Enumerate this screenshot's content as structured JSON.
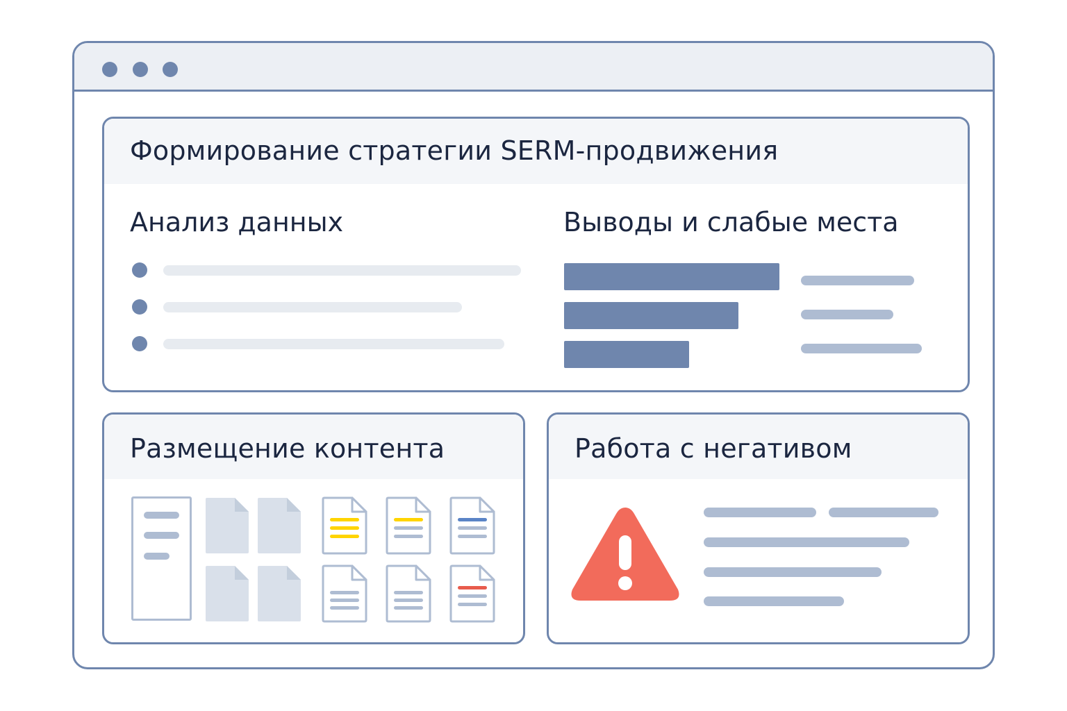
{
  "window": {
    "controls": [
      "dot-1",
      "dot-2",
      "dot-3"
    ]
  },
  "strategy": {
    "title": "Формирование стратегии SERM-продвижения",
    "analysis_heading": "Анализ данных",
    "findings_heading": "Выводы и слабые места",
    "findings_bar_levels": [
      1.0,
      0.81,
      0.58
    ]
  },
  "content": {
    "title": "Размещение контента",
    "files": [
      {
        "icon": "blank-file-icon"
      },
      {
        "icon": "blank-file-icon"
      },
      {
        "icon": "yellow-highlight-file-icon",
        "accent": "#ffd400"
      },
      {
        "icon": "yellow-line-file-icon",
        "accent": "#ffd400"
      },
      {
        "icon": "blue-line-file-icon",
        "accent": "#5a84c6"
      },
      {
        "icon": "blank-file-icon"
      },
      {
        "icon": "blank-file-icon"
      },
      {
        "icon": "text-file-icon"
      },
      {
        "icon": "text-file-icon"
      },
      {
        "icon": "red-line-file-icon",
        "accent": "#e85b4c"
      }
    ]
  },
  "negative": {
    "title": "Работа с негативом",
    "icon": "warning-icon",
    "icon_color": "#f26b5b"
  },
  "colors": {
    "border": "#6f86ad",
    "bar": "#6f86ad",
    "skeleton_light": "#e7ebf0",
    "skeleton": "#aebcd2",
    "yellow": "#ffd400",
    "blue": "#5a84c6",
    "red": "#e85b4c"
  }
}
